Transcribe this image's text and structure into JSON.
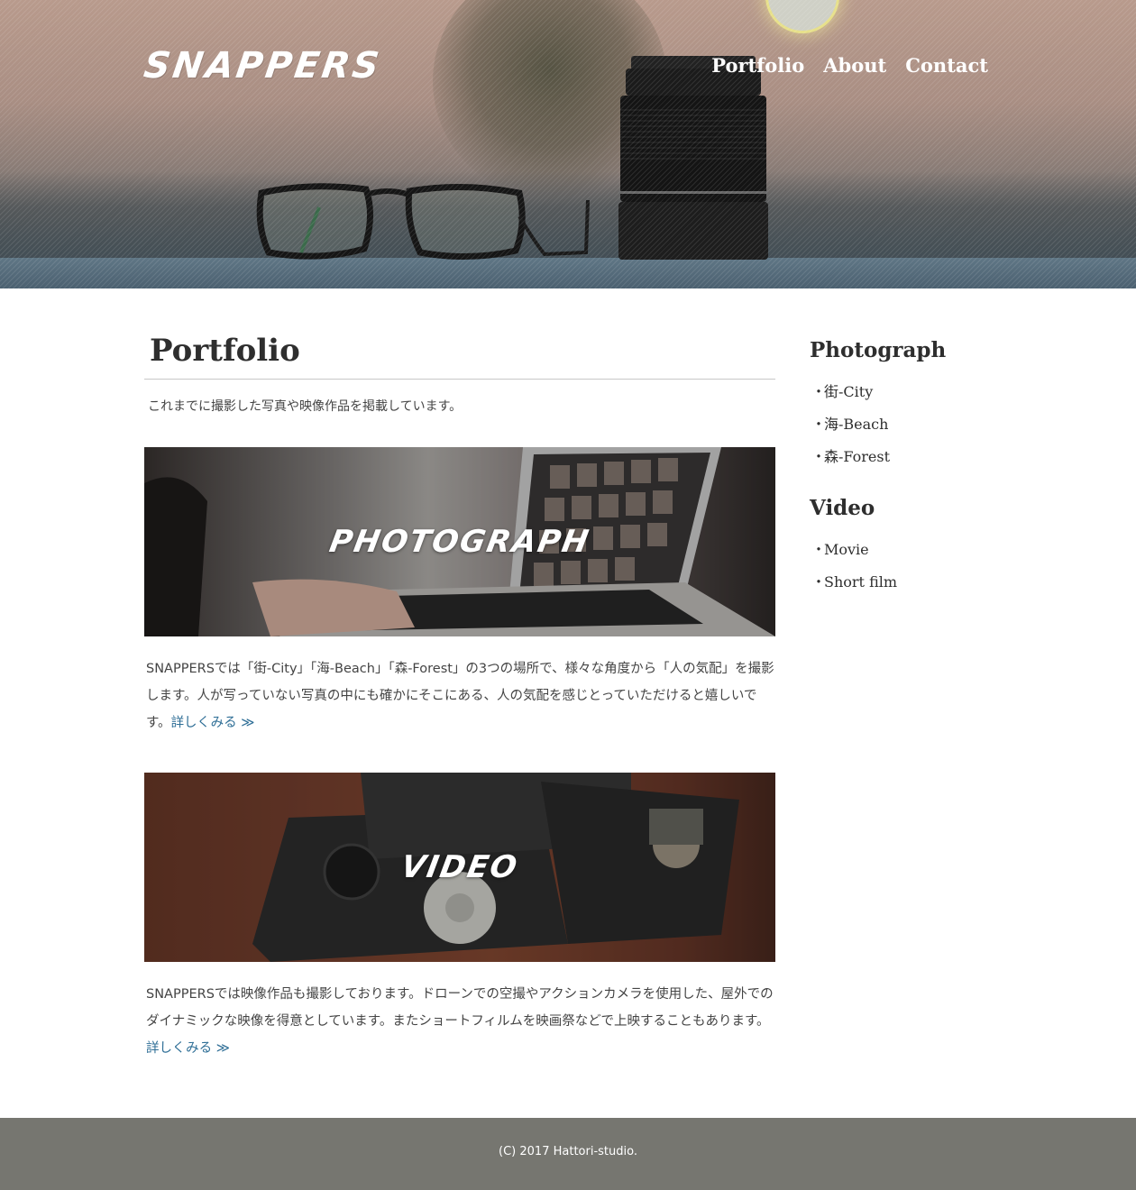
{
  "header": {
    "logo": "SNAPPERS",
    "nav": [
      "Portfolio",
      "About",
      "Contact"
    ]
  },
  "main": {
    "title": "Portfolio",
    "intro": "これまでに撮影した写真や映像作品を掲載しています。",
    "sections": [
      {
        "banner_label": "PHOTOGRAPH",
        "description": "SNAPPERSでは「街-City」「海-Beach」「森-Forest」の3つの場所で、様々な角度から「人の気配」を撮影します。人が写っていない写真の中にも確かにそこにある、人の気配を感じとっていただけると嬉しいです。",
        "more_link": "詳しくみる ≫"
      },
      {
        "banner_label": "VIDEO",
        "description": "SNAPPERSでは映像作品も撮影しております。ドローンでの空撮やアクションカメラを使用した、屋外でのダイナミックな映像を得意としています。またショートフィルムを映画祭などで上映することもあります。",
        "more_link": "詳しくみる ≫"
      }
    ]
  },
  "sidebar": {
    "groups": [
      {
        "heading": "Photograph",
        "items": [
          "街-City",
          "海-Beach",
          "森-Forest"
        ]
      },
      {
        "heading": "Video",
        "items": [
          "Movie",
          "Short film"
        ]
      }
    ],
    "bullet": "・"
  },
  "footer": {
    "copyright": "(C) 2017 Hattori-studio."
  },
  "colors": {
    "link": "#2e6e96",
    "footer_bg": "#767670",
    "text": "#333333"
  }
}
